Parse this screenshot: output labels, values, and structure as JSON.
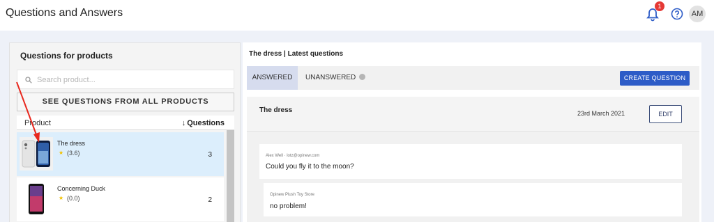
{
  "header": {
    "title": "Questions and Answers",
    "notification_count": "1",
    "avatar_initials": "AM"
  },
  "left": {
    "title": "Questions for products",
    "search_placeholder": "Search product...",
    "all_products_button": "SEE QUESTIONS FROM ALL PRODUCTS",
    "col_product": "Product",
    "col_questions": "Questions",
    "sort_arrow": "↓",
    "products": [
      {
        "name": "The dress",
        "rating": "(3.6)",
        "questions": "3"
      },
      {
        "name": "Concerning Duck",
        "rating": "(0.0)",
        "questions": "2"
      }
    ],
    "star_glyph": "★"
  },
  "right": {
    "breadcrumb": "The dress | Latest questions",
    "tabs": {
      "answered": "ANSWERED",
      "unanswered": "UNANSWERED"
    },
    "create_button": "CREATE QUESTION",
    "question": {
      "product": "The dress",
      "date": "23rd March 2021",
      "edit_button": "EDIT",
      "author": "Alex Well · lotz@opinew.com",
      "text": "Could you fly it to the moon?"
    },
    "answer": {
      "author": "Opinew Plush Toy Store",
      "text": "no problem!"
    }
  },
  "colors": {
    "accent": "#2d5cc7",
    "selected_row": "#dceefc",
    "badge": "#e53935",
    "annotation_arrow": "#e8281e"
  },
  "icons": [
    "bell-icon",
    "help-icon",
    "search-icon",
    "star-icon",
    "sort-down-icon"
  ]
}
